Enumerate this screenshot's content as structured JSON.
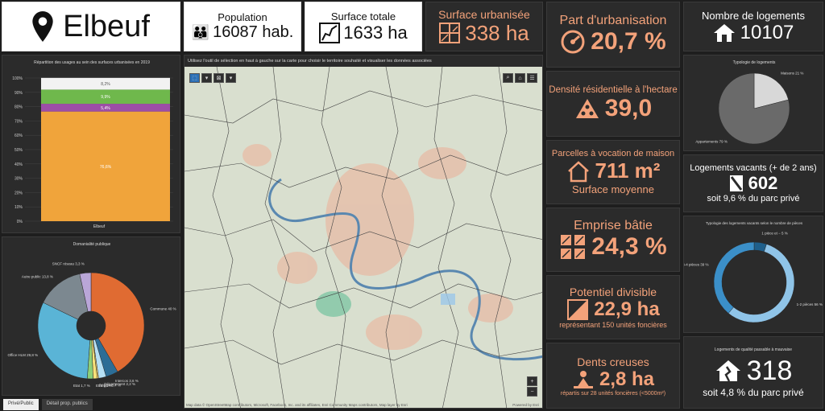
{
  "header": {
    "city": "Elbeuf",
    "population": {
      "title": "Population",
      "value": "16087 hab."
    },
    "surface_totale": {
      "title": "Surface totale",
      "value": "1633 ha"
    },
    "surface_urbanisee": {
      "title": "Surface urbanisée",
      "value": "338 ha"
    }
  },
  "map": {
    "instruction": "Utilisez l'outil de sélection en haut à gauche sur la carte pour choisir le territoire souhaité et visualiser les données associées",
    "attribution": "Map data © OpenStreetMap contributors, Microsoft, Facebook, Inc. and its affiliates, Esri Community Maps contributors, Map layer by Esri",
    "powered": "Powered by Esri",
    "zoom_in": "+",
    "zoom_out": "−"
  },
  "kpis_mid": [
    {
      "title": "Part d'urbanisation",
      "value": "20,7 %"
    },
    {
      "title": "Densité résidentielle à l'hectare",
      "value": "39,0"
    },
    {
      "title": "Parcelles à vocation de maison",
      "value": "711 m²",
      "sub": "Surface moyenne"
    },
    {
      "title": "Emprise bâtie",
      "value": "24,3 %"
    },
    {
      "title": "Potentiel divisible",
      "value": "22,9 ha",
      "sub": "représentant 150 unités foncières"
    },
    {
      "title": "Dents creuses",
      "value": "2,8 ha",
      "sub": "répartis sur 28 unités foncières (<5000m²)"
    }
  ],
  "kpis_right": {
    "logements": {
      "title": "Nombre de logements",
      "value": "10107"
    },
    "vacants": {
      "title": "Logements vacants (+ de 2 ans)",
      "value": "602",
      "sub": "soit 9,6 % du parc privé"
    },
    "mauvaise": {
      "title": "Logements de qualité passable à mauvaise",
      "value": "318",
      "sub": "soit 4,8 % du parc privé"
    }
  },
  "tabs": [
    "Privé/Public",
    "Détail prop. publics"
  ],
  "chart_data": [
    {
      "type": "bar",
      "title": "Répartition des usages au sein des surfaces urbanisées en 2019",
      "categories": [
        "Elbeuf"
      ],
      "yticks": [
        "0%",
        "10%",
        "20%",
        "30%",
        "40%",
        "50%",
        "60%",
        "70%",
        "80%",
        "90%",
        "100%"
      ],
      "series": [
        {
          "label": "76,6%",
          "value": 76.6,
          "color": "#f0a43b"
        },
        {
          "label": "5,4%",
          "value": 5.4,
          "color": "#9d4ea7"
        },
        {
          "label": "9,9%",
          "value": 9.9,
          "color": "#6fb84c"
        },
        {
          "label": "8,2%",
          "value": 8.2,
          "color": "#f2f2f2"
        }
      ],
      "ylim": [
        0,
        100
      ]
    },
    {
      "type": "pie",
      "title": "Domanialité publique",
      "slices": [
        {
          "label": "Commune 40 %",
          "value": 40,
          "color": "#e06b32"
        },
        {
          "label": "Intercos 3,6 %",
          "value": 3.6,
          "color": "#2c6d96"
        },
        {
          "label": "Département 2,2 %",
          "value": 2.2,
          "color": "#b6e0f5"
        },
        {
          "label": "Région 0,4 %",
          "value": 0.4,
          "color": "#f6d46b"
        },
        {
          "label": "Etat 1,2 %",
          "value": 1.2,
          "color": "#f9e27a"
        },
        {
          "label": "Etat 1,7 %",
          "value": 1.7,
          "color": "#8ccf7a"
        },
        {
          "label": "Office HLM 29,8 %",
          "value": 29.8,
          "color": "#5ab4d6"
        },
        {
          "label": "Autre public 13,8 %",
          "value": 13.8,
          "color": "#7c8890"
        },
        {
          "label": "SNCF réseau 3,3 %",
          "value": 3.3,
          "color": "#b9a6d8"
        }
      ]
    },
    {
      "type": "pie",
      "title": "Typologie de logements",
      "slices": [
        {
          "label": "Maisons 21 %",
          "value": 21,
          "color": "#d8d8d8"
        },
        {
          "label": "Appartements 79 %",
          "value": 79,
          "color": "#6a6a6a"
        }
      ]
    },
    {
      "type": "pie",
      "title": "Typologie des logements vacants selon le nombre de pièces",
      "slices": [
        {
          "label": "1 pièce et − 5 %",
          "value": 5,
          "color": "#1f5f8b"
        },
        {
          "label": "1-2 pièces 56 %",
          "value": 56,
          "color": "#8fc4e8"
        },
        {
          "label": "3-4 pièces 39 %",
          "value": 39,
          "color": "#3b8fc8"
        }
      ]
    }
  ]
}
